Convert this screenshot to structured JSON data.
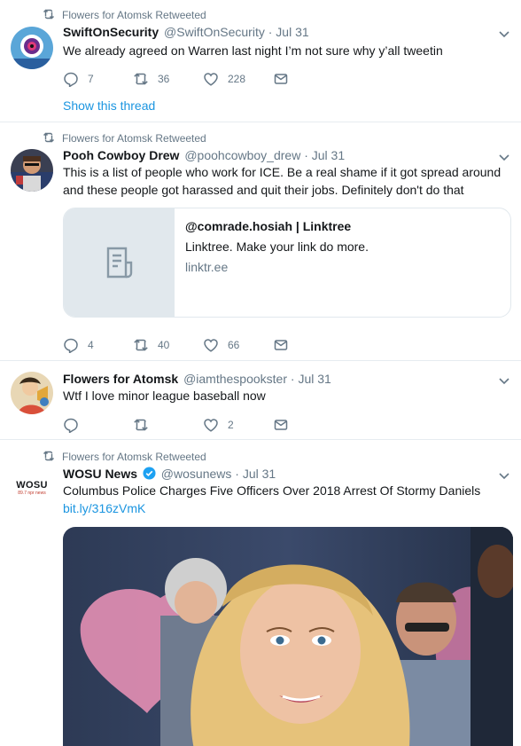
{
  "tweets": [
    {
      "retweet_label": "Flowers for Atomsk Retweeted",
      "name": "SwiftOnSecurity",
      "handle": "@SwiftOnSecurity",
      "date": "· Jul 31",
      "text": "We already agreed on Warren last night I’m not sure why y’all tweetin",
      "replies": "7",
      "retweets": "36",
      "likes": "228",
      "show_thread": "Show this thread"
    },
    {
      "retweet_label": "Flowers for Atomsk Retweeted",
      "name": "Pooh Cowboy Drew",
      "handle": "@poohcowboy_drew",
      "date": "· Jul 31",
      "text": "This is a list of people who work for  ICE. Be a real shame if it got spread around and these people got harassed and quit their jobs. Definitely don't do that",
      "card": {
        "title": "@comrade.hosiah | Linktree",
        "description": "Linktree. Make your link do more.",
        "url": "linktr.ee"
      },
      "replies": "4",
      "retweets": "40",
      "likes": "66"
    },
    {
      "name": "Flowers for Atomsk",
      "handle": "@iamthespookster",
      "date": "· Jul 31",
      "text": "Wtf I love minor league baseball now",
      "replies": "",
      "retweets": "",
      "likes": "2"
    },
    {
      "retweet_label": "Flowers for Atomsk Retweeted",
      "name": "WOSU News",
      "handle": "@wosunews",
      "date": "· Jul 31",
      "text": "Columbus Police Charges Five Officers Over 2018 Arrest Of Stormy Daniels",
      "link": "bit.ly/316zVmK",
      "avatar_text": "WOSU",
      "avatar_sub": "89.7 npr news"
    }
  ],
  "colors": {
    "link": "#1b95e0",
    "meta": "#657786",
    "border": "#e6ecf0",
    "verified": "#1da1f2"
  },
  "icons": [
    "retweet-icon",
    "reply-icon",
    "like-icon",
    "message-icon",
    "chevron-down-icon",
    "verified-icon",
    "document-icon"
  ]
}
